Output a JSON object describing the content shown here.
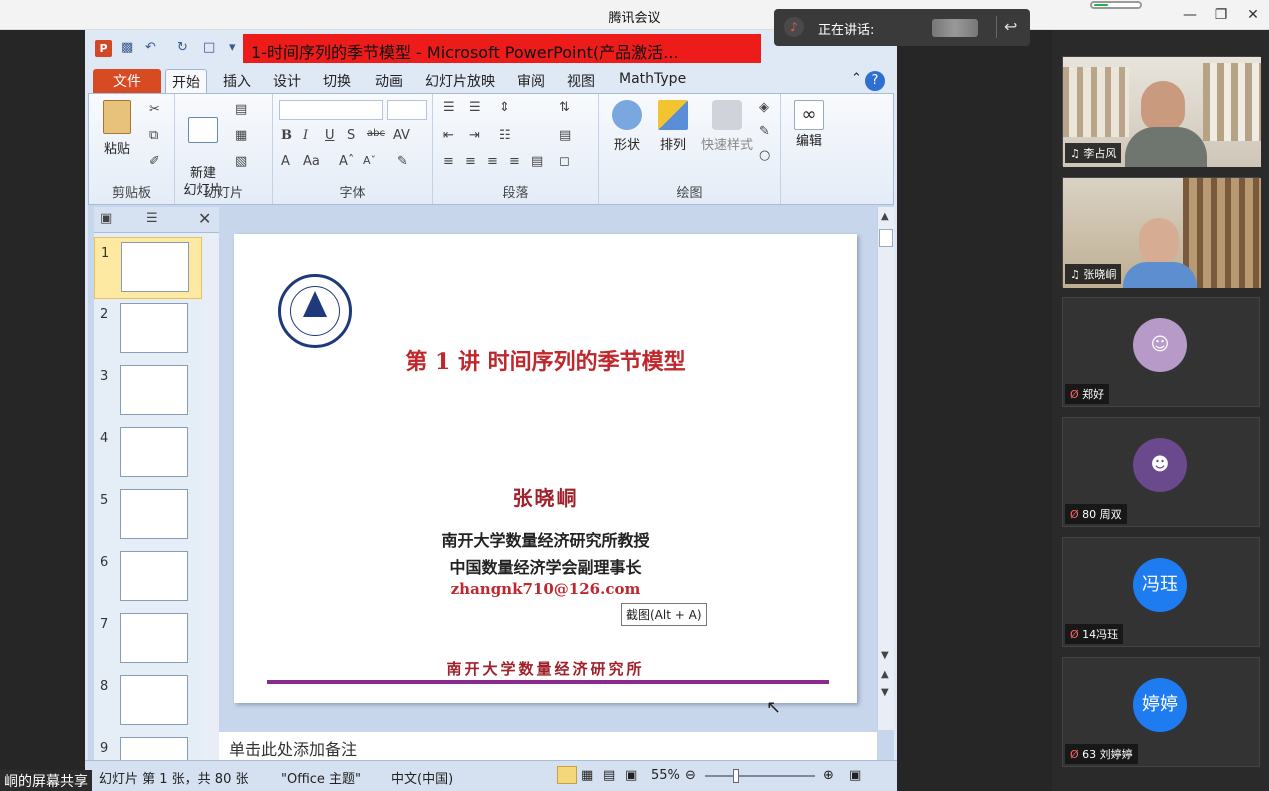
{
  "window": {
    "title": "腾讯会议"
  },
  "speaking": {
    "label": "正在讲话:"
  },
  "ppt": {
    "doc_title": "1-时间序列的季节模型 - Microsoft PowerPoint(产品激活...",
    "tabs": [
      "文件",
      "开始",
      "插入",
      "设计",
      "切换",
      "动画",
      "幻灯片放映",
      "审阅",
      "视图",
      "MathType"
    ],
    "ribbon": {
      "paste": "粘贴",
      "clipboard": "剪贴板",
      "new_slide": "新建\n幻灯片",
      "slides": "幻灯片",
      "font": "字体",
      "paragraph": "段落",
      "shape": "形状",
      "arrange": "排列",
      "quick_style": "快速样式",
      "drawing": "绘图",
      "edit": "编辑"
    },
    "thumb_numbers": [
      "1",
      "2",
      "3",
      "4",
      "5",
      "6",
      "7",
      "8",
      "9"
    ],
    "slide": {
      "title": "第 1 讲  时间序列的季节模型",
      "author": "张晓峒",
      "line1": "南开大学数量经济研究所教授",
      "line2": "中国数量经济学会副理事长",
      "email": "zhangnk710@126.com",
      "institute": "南开大学数量经济研究所"
    },
    "tooltip": "截图(Alt + A)",
    "notes_placeholder": "单击此处添加备注",
    "status": {
      "slide_info": "幻灯片 第 1 张，共 80 张",
      "theme": "\"Office 主题\"",
      "lang": "中文(中国)",
      "zoom": "55%"
    }
  },
  "share_label": "峒的屏幕共享",
  "participants": [
    {
      "name": "李占风",
      "type": "video"
    },
    {
      "name": "张晓峒",
      "type": "video"
    },
    {
      "name": "郑好",
      "type": "avatar",
      "color": "#b89ac9"
    },
    {
      "name": "80 周双",
      "type": "avatar",
      "color": "#6a4a8c"
    },
    {
      "name": "14冯珏",
      "type": "text",
      "avatar_text": "冯珏",
      "color": "#1f7cf0"
    },
    {
      "name": "63 刘婷婷",
      "type": "text",
      "avatar_text": "婷婷",
      "color": "#1f7cf0"
    }
  ]
}
